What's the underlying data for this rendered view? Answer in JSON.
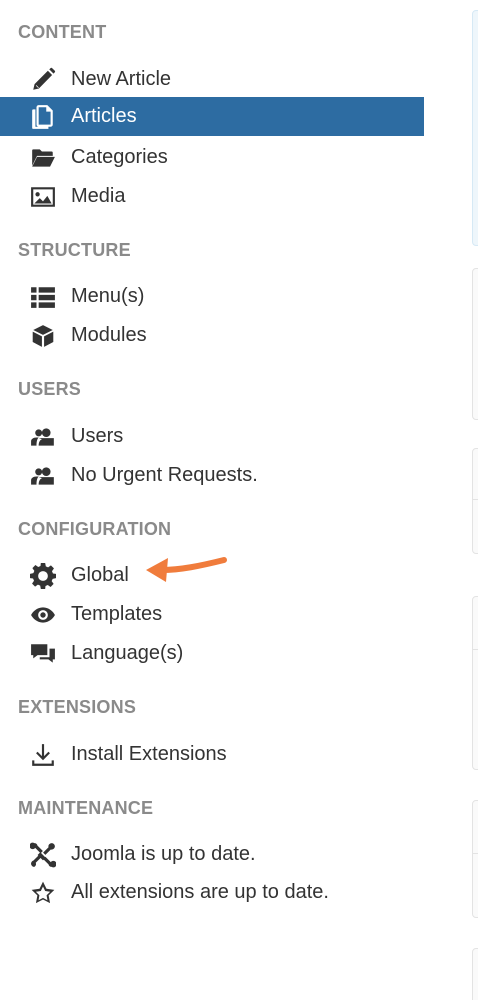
{
  "sidebar": {
    "sections": [
      {
        "title": "CONTENT"
      },
      {
        "title": "STRUCTURE"
      },
      {
        "title": "USERS"
      },
      {
        "title": "CONFIGURATION"
      },
      {
        "title": "EXTENSIONS"
      },
      {
        "title": "MAINTENANCE"
      }
    ],
    "items": [
      {
        "label": "New Article",
        "icon": "pencil-icon"
      },
      {
        "label": "Articles",
        "icon": "copy-icon",
        "active": true
      },
      {
        "label": "Categories",
        "icon": "folder-open-icon"
      },
      {
        "label": "Media",
        "icon": "image-icon"
      },
      {
        "label": "Menu(s)",
        "icon": "list-icon"
      },
      {
        "label": "Modules",
        "icon": "cube-icon"
      },
      {
        "label": "Users",
        "icon": "users-icon"
      },
      {
        "label": "No Urgent Requests.",
        "icon": "users-icon"
      },
      {
        "label": "Global",
        "icon": "cog-icon"
      },
      {
        "label": "Templates",
        "icon": "eye-icon"
      },
      {
        "label": "Language(s)",
        "icon": "comments-icon"
      },
      {
        "label": "Install Extensions",
        "icon": "download-icon"
      },
      {
        "label": "Joomla is up to date.",
        "icon": "joomla-icon"
      },
      {
        "label": "All extensions are up to date.",
        "icon": "star-icon"
      }
    ]
  },
  "colors": {
    "active_bg": "#2d6ca2",
    "section_title": "#8a8a8a",
    "annotation_arrow": "#f07c3c"
  }
}
